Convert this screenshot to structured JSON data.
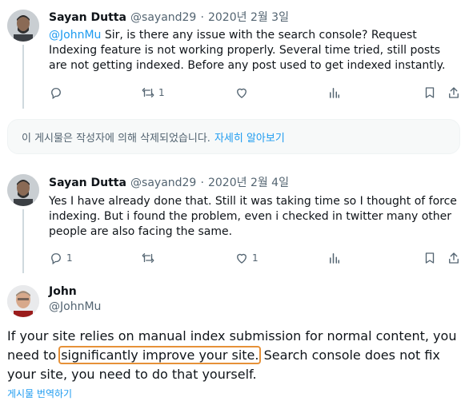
{
  "tweet1": {
    "author_name": "Sayan Dutta",
    "handle": "@sayand29",
    "separator": "·",
    "date": "2020년 2월 3일",
    "mention": "@JohnMu",
    "text": " Sir, is there any issue with the search console? Request Indexing feature is not working properly. Several time tried, still posts are not getting indexed. Before any post used to get indexed instantly.",
    "reply_count": "",
    "retweet_count": "1",
    "like_count": ""
  },
  "deleted_notice": {
    "text": "이 게시물은 작성자에 의해 삭제되었습니다.",
    "link": "자세히 알아보기"
  },
  "tweet2": {
    "author_name": "Sayan Dutta",
    "handle": "@sayand29",
    "separator": "·",
    "date": "2020년 2월 4일",
    "text": "Yes I have already done that. Still it was taking time so I thought of force indexing. But i found the problem, even i checked in twitter many other people are also facing the same.",
    "reply_count": "1",
    "retweet_count": "",
    "like_count": "1"
  },
  "tweet3": {
    "author_name": "John",
    "handle": "@JohnMu",
    "text_before": "If your site relies on manual index submission for normal content, you need to ",
    "text_highlight": "significantly improve your site.",
    "text_after": " Search console does not fix your site, you need to do that yourself.",
    "translate_label": "게시물 번역하기"
  },
  "icons": [
    "reply-icon",
    "retweet-icon",
    "like-icon",
    "views-icon",
    "bookmark-icon",
    "share-icon"
  ],
  "colors": {
    "accent": "#1d9bf0",
    "secondary_text": "#536471",
    "highlight_box": "#e69138"
  }
}
